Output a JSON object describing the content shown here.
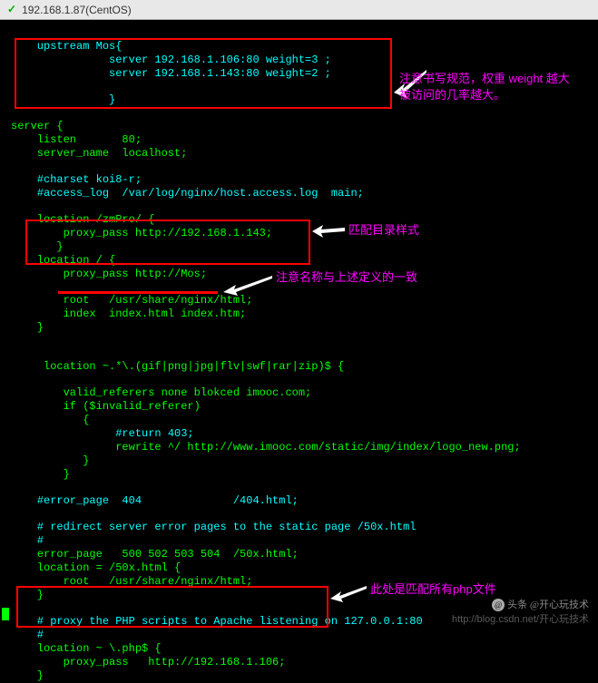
{
  "titlebar": {
    "checkmark": "✓",
    "title": "192.168.1.87(CentOS)"
  },
  "config": {
    "upstream_header": "    upstream Mos{",
    "upstream_line1": "               server 192.168.1.106:80 weight=3 ;",
    "upstream_line2": "               server 192.168.1.143:80 weight=2 ;",
    "upstream_close": "               }",
    "server_open": "server {",
    "listen": "    listen       80;",
    "server_name": "    server_name  localhost;",
    "charset": "    #charset koi8-r;",
    "access_log": "    #access_log  /var/log/nginx/host.access.log  main;",
    "loc_zmpro": "    location /zmPro/ {",
    "proxy1": "        proxy_pass http://192.168.1.143;",
    "loc_zm_close": "       }",
    "loc_root": "    location / {",
    "proxy2": "        proxy_pass http://Mos;",
    "root_dir": "        root   /usr/share/nginx/html;",
    "index_dir": "        index  index.html index.htm;",
    "loc_close": "    }",
    "loc_regex": "     location ~.*\\.(gif|png|jpg|flv|swf|rar|zip)$ {",
    "valid_ref": "        valid_referers none blokced imooc.com;",
    "if_invalid": "        if ($invalid_referer)",
    "brace_open": "           {",
    "return403": "                #return 403;",
    "rewrite": "                rewrite ^/ http://www.imooc.com/static/img/index/logo_new.png;",
    "brace_c1": "           }",
    "brace_c2": "        }",
    "error_page": "    #error_page  404              /404.html;",
    "redirect_comment": "    # redirect server error pages to the static page /50x.html",
    "hash": "    #",
    "error_page2": "    error_page   500 502 503 504  /50x.html;",
    "loc_50x": "    location = /50x.html {",
    "root_50x": "        root   /usr/share/nginx/html;",
    "close_50x": "    }",
    "proxy_comment": "    # proxy the PHP scripts to Apache listening on 127.0.0.1:80",
    "hash2": "    #",
    "loc_php": "    location ~ \\.php$ {",
    "proxy3": "        proxy_pass   http://192.168.1.106;",
    "close_php": "    }"
  },
  "annotations": {
    "ann1": "注意书写规范，权重 weight 越大",
    "ann1b": "被访问的几率越大。",
    "ann2": "匹配目录样式",
    "ann3": "注意名称与上述定义的一致",
    "ann4": "此处是匹配所有php文件"
  },
  "footer": {
    "toutiao": "头条 @开心玩技术",
    "watermark": "http://blog.csdn.net/开心玩技术"
  }
}
